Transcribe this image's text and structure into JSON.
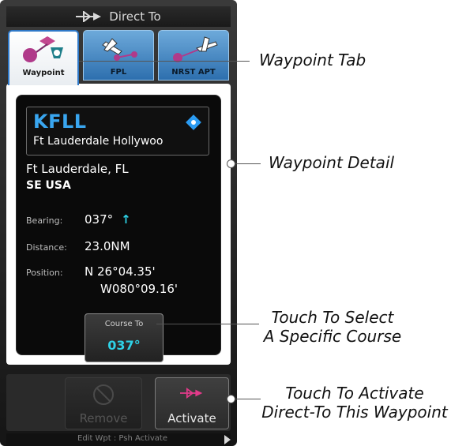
{
  "title_bar": {
    "title": "Direct To",
    "icon": "direct-to-icon"
  },
  "tabs": [
    {
      "label": "Waypoint",
      "icon": "waypoint-tab-icon",
      "active": true
    },
    {
      "label": "FPL",
      "icon": "flight-plan-icon",
      "active": false
    },
    {
      "label": "NRST APT",
      "icon": "nearest-airport-icon",
      "active": false
    }
  ],
  "waypoint": {
    "ident": "KFLL",
    "name": "Ft Lauderdale Hollywoo",
    "city": "Ft Lauderdale, FL",
    "region": "SE USA",
    "bearing_label": "Bearing:",
    "bearing_value": "037°",
    "distance_label": "Distance:",
    "distance_value": "23.0NM",
    "position_label": "Position:",
    "lat": "N 26°04.35'",
    "lon": "W080°09.16'",
    "course_label": "Course To",
    "course_value": "037°",
    "colors": {
      "ident": "#39a6f0",
      "value_accent": "#2ed2e6"
    }
  },
  "buttons": {
    "remove": "Remove",
    "activate": "Activate"
  },
  "status_bar": {
    "hint": "Edit Wpt : Psh Activate"
  },
  "callouts": {
    "waypoint_tab": "Waypoint Tab",
    "waypoint_detail": "Waypoint Detail",
    "course_line1": "Touch To Select",
    "course_line2": "A Specific Course",
    "activate_line1": "Touch To Activate",
    "activate_line2": "Direct-To This Waypoint"
  }
}
